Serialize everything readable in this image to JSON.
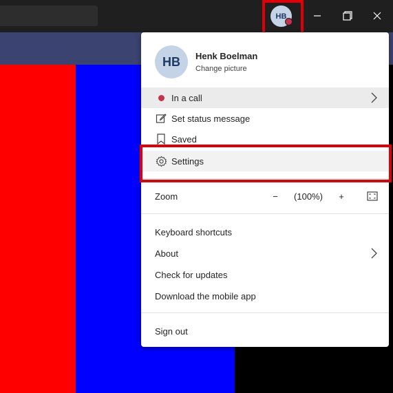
{
  "profile": {
    "initials": "HB",
    "name": "Henk Boelman",
    "change_picture": "Change picture"
  },
  "menu": {
    "status": "In a call",
    "set_status": "Set status message",
    "saved": "Saved",
    "settings": "Settings",
    "zoom": {
      "label": "Zoom",
      "minus": "−",
      "value": "(100%)",
      "plus": "+"
    },
    "keyboard_shortcuts": "Keyboard shortcuts",
    "about": "About",
    "check_updates": "Check for updates",
    "download_app": "Download the mobile app",
    "sign_out": "Sign out"
  },
  "colors": {
    "status_busy": "#c4314b",
    "highlight": "#e0000a",
    "panel_red": "#ff0000",
    "panel_blue": "#0000ff"
  },
  "icons": [
    "status-dot-icon",
    "edit-status-icon",
    "bookmark-icon",
    "gear-icon",
    "chevron-right-icon",
    "fullscreen-icon",
    "minimize-icon",
    "restore-icon",
    "close-icon"
  ]
}
